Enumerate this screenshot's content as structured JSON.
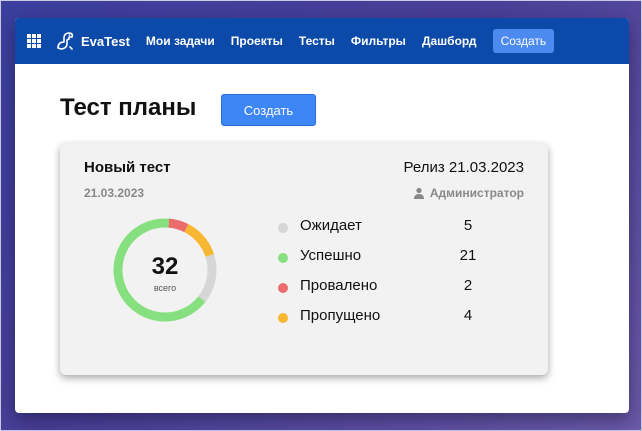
{
  "header": {
    "brand": "EvaTest",
    "nav": [
      "Мои задачи",
      "Проекты",
      "Тесты",
      "Фильтры",
      "Дашборд"
    ],
    "create_label": "Создать"
  },
  "page": {
    "title": "Тест планы",
    "create_label": "Создать"
  },
  "card": {
    "name": "Новый тест",
    "date": "21.03.2023",
    "release": "Релиз 21.03.2023",
    "user": "Администратор",
    "total": "32",
    "total_label": "всего",
    "stats": [
      {
        "label": "Ожидает",
        "value": 5,
        "color": "#d6d6d6"
      },
      {
        "label": "Успешно",
        "value": 21,
        "color": "#86e07f"
      },
      {
        "label": "Провалено",
        "value": 2,
        "color": "#ea6c6c"
      },
      {
        "label": "Пропущено",
        "value": 4,
        "color": "#f7b733"
      }
    ]
  }
}
